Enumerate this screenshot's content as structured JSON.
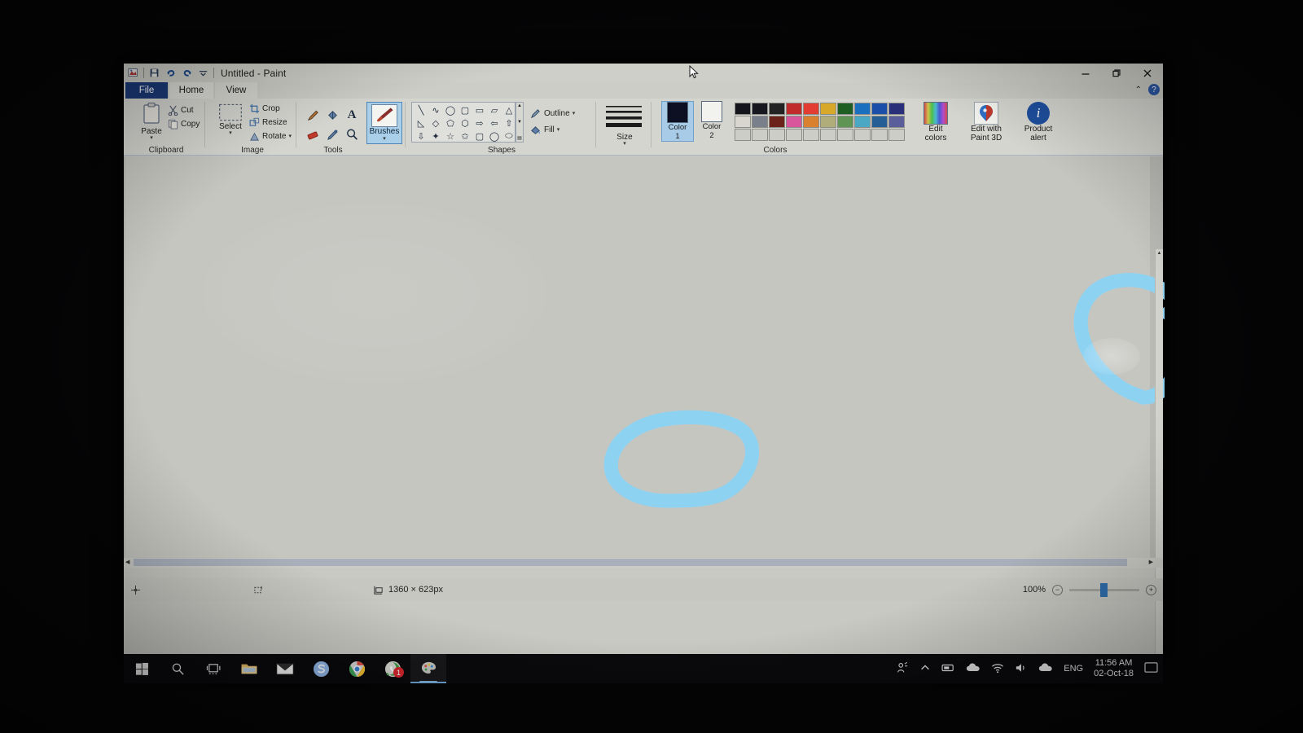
{
  "window": {
    "title": "Untitled - Paint",
    "app_icon": "paint-icon",
    "quick_access": [
      {
        "name": "save-icon",
        "glyph": "💾"
      },
      {
        "name": "undo-icon",
        "glyph": "↶"
      },
      {
        "name": "redo-icon",
        "glyph": "↷"
      },
      {
        "name": "customize-quick-access-icon",
        "glyph": "▾"
      }
    ],
    "controls": {
      "minimize": "─",
      "restore": "❐",
      "close": "✕"
    }
  },
  "tabs": [
    {
      "label": "File",
      "name": "tab-file"
    },
    {
      "label": "Home",
      "name": "tab-home"
    },
    {
      "label": "View",
      "name": "tab-view"
    }
  ],
  "ribbon_controls": {
    "collapse": "⌃",
    "help": "?"
  },
  "ribbon": {
    "groups": [
      {
        "name": "clipboard",
        "label": "Clipboard",
        "paste_label": "Paste",
        "items": [
          {
            "label": "Cut",
            "icon": "scissors-icon"
          },
          {
            "label": "Copy",
            "icon": "copy-icon"
          }
        ]
      },
      {
        "name": "image",
        "label": "Image",
        "select_label": "Select",
        "items": [
          {
            "label": "Crop",
            "icon": "crop-icon"
          },
          {
            "label": "Resize",
            "icon": "resize-icon"
          },
          {
            "label": "Rotate",
            "icon": "rotate-icon"
          }
        ]
      },
      {
        "name": "tools",
        "label": "Tools",
        "items": [
          {
            "icon": "pencil-icon"
          },
          {
            "icon": "fill-with-color-icon"
          },
          {
            "icon": "text-icon"
          },
          {
            "icon": "eraser-icon"
          },
          {
            "icon": "color-picker-icon"
          },
          {
            "icon": "magnifier-icon"
          }
        ],
        "brushes_label": "Brushes",
        "brushes_selected": true
      },
      {
        "name": "shapes",
        "label": "Shapes",
        "outline_label": "Outline",
        "fill_label": "Fill",
        "shape_glyphs": [
          "╲",
          "∿",
          "◯",
          "▢",
          "▭",
          "▱",
          "△",
          "◺",
          "◇",
          "⬠",
          "⬡",
          "⇨",
          "⇦",
          "⇧",
          "⇩",
          "✦",
          "☆",
          "✩",
          "▢",
          "◯",
          "⬭"
        ]
      },
      {
        "name": "size",
        "label": "Size"
      },
      {
        "name": "colors",
        "label": "Colors",
        "color1_label": "Color",
        "color1_sub": "1",
        "color2_label": "Color",
        "color2_sub": "2",
        "color1_value": "#0d1022",
        "color2_value": "#f2f2ee",
        "palette_row1": [
          "#14141c",
          "#17171f",
          "#232323",
          "#c22b2b",
          "#e23c33",
          "#d7a829",
          "#1f5e23",
          "#1b6fbf",
          "#1b4ea8",
          "#2a2f7a"
        ],
        "palette_row2": [
          "#d8d6cf",
          "#7a7f8c",
          "#6b2218",
          "#d9569c",
          "#d9812f",
          "#b0ad7a",
          "#5f9455",
          "#4aa8c4",
          "#265f96",
          "#5a5f9c"
        ],
        "palette_row3": [
          "#cdcdc8",
          "#cdcdc8",
          "#cdcdc8",
          "#cdcdc8",
          "#cdcdc8",
          "#cdcdc8",
          "#cdcdc8",
          "#cdcdc8",
          "#cdcdc8",
          "#cdcdc8"
        ],
        "edit_colors_label_1": "Edit",
        "edit_colors_label_2": "colors",
        "paint3d_label_1": "Edit with",
        "paint3d_label_2": "Paint 3D",
        "product_alert_label_1": "Product",
        "product_alert_label_2": "alert"
      }
    ]
  },
  "status_bar": {
    "cursor_position_icon": "cursor-position-icon",
    "selection_size_icon": "selection-size-icon",
    "image_size_icon": "image-size-icon",
    "image_size": "1360 × 623px",
    "zoom_level": "100%",
    "zoom_out": "−",
    "zoom_in": "+"
  },
  "canvas": {
    "drawing_color": "#8ed2f2",
    "strokes": [
      {
        "name": "hand-drawn-circle-center"
      },
      {
        "name": "hand-drawn-circle-right"
      }
    ]
  },
  "taskbar": {
    "items": [
      {
        "name": "start-button",
        "icon": "windows-logo-icon"
      },
      {
        "name": "search-button",
        "icon": "search-icon"
      },
      {
        "name": "task-view-button",
        "icon": "task-view-icon"
      },
      {
        "name": "file-explorer-button",
        "icon": "folder-icon"
      },
      {
        "name": "mail-button",
        "icon": "mail-icon"
      },
      {
        "name": "skype-button",
        "icon": "skype-icon"
      },
      {
        "name": "chrome-button",
        "icon": "chrome-icon"
      },
      {
        "name": "whatsapp-button",
        "icon": "whatsapp-icon",
        "badge": "1"
      },
      {
        "name": "paint-button",
        "icon": "paint-icon",
        "active": true
      }
    ],
    "tray": [
      {
        "name": "meet-now-icon",
        "glyph": "⚑"
      },
      {
        "name": "show-hidden-icons-icon",
        "glyph": "⌃"
      },
      {
        "name": "removable-media-icon",
        "glyph": "▭"
      },
      {
        "name": "onedrive-icon",
        "glyph": "☁"
      },
      {
        "name": "network-icon",
        "glyph": "◠"
      },
      {
        "name": "volume-icon",
        "glyph": "🔈"
      },
      {
        "name": "cloud-sync-icon",
        "glyph": "☁"
      }
    ],
    "language": "ENG",
    "time": "11:56 AM",
    "date": "02-Oct-18",
    "action_center_icon": "action-center-icon"
  }
}
